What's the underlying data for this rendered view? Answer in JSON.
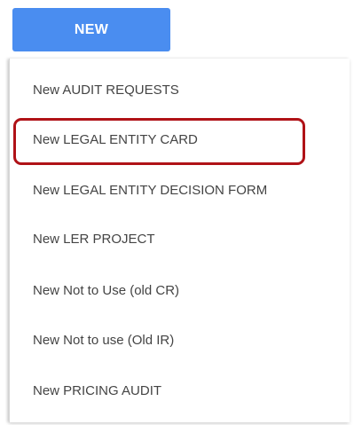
{
  "button": {
    "label": "NEW"
  },
  "menu": {
    "items": [
      "New AUDIT REQUESTS",
      "New LEGAL ENTITY CARD",
      "New LEGAL ENTITY DECISION FORM",
      "New LER PROJECT",
      "New Not to Use (old CR)",
      "New Not to use (Old IR)",
      "New PRICING AUDIT"
    ],
    "highlighted_item": "New LEGAL ENTITY CARD"
  },
  "colors": {
    "button_background": "#4a8df0",
    "highlight_border": "#b01217",
    "item_text": "#444444"
  }
}
